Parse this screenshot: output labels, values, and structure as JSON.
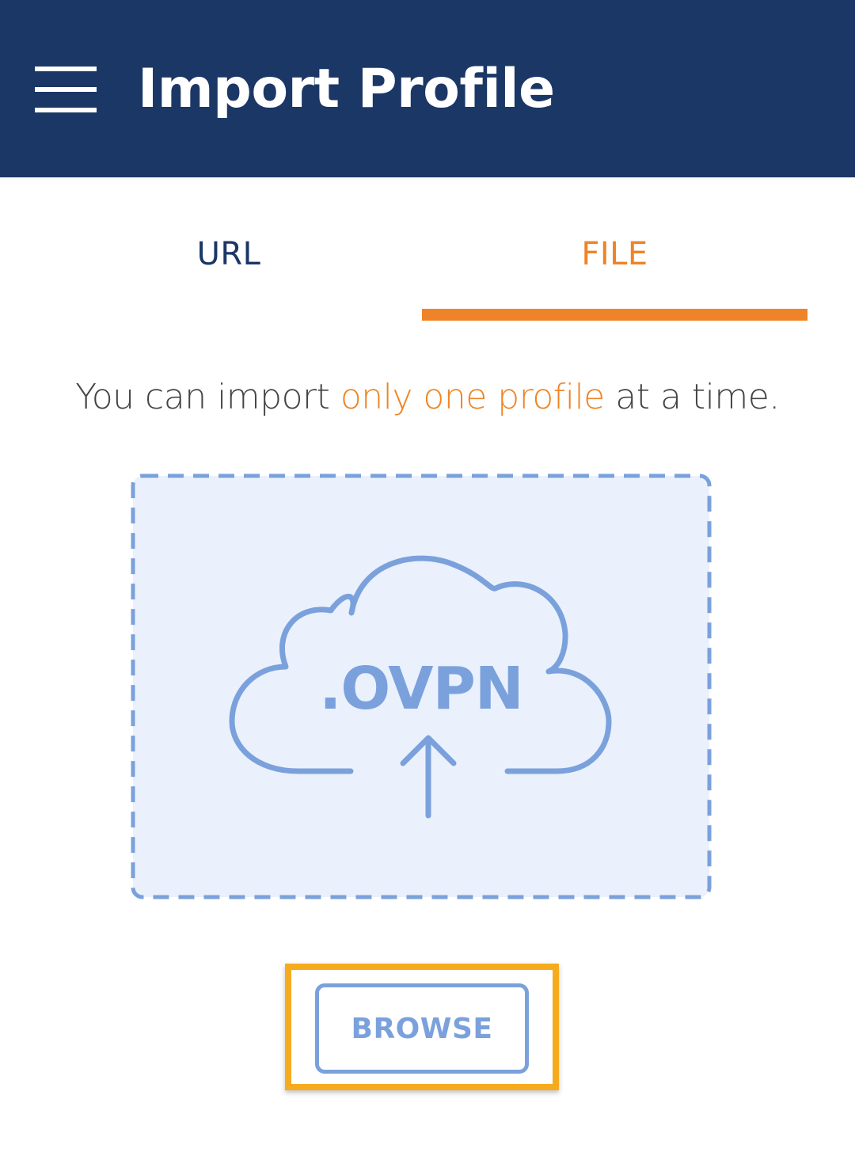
{
  "header": {
    "title": "Import Profile",
    "menu_icon": "hamburger-menu-icon",
    "background_color": "#1b3766"
  },
  "tabs": [
    {
      "label": "URL",
      "selected": false
    },
    {
      "label": "FILE",
      "selected": true
    }
  ],
  "hint": {
    "before": "You can import ",
    "highlight": "only one profile",
    "after": " at a time."
  },
  "dropzone": {
    "label": ".OVPN",
    "icon": "cloud-upload-icon"
  },
  "browse_button": {
    "label": "BROWSE"
  },
  "colors": {
    "accent": "#ee8427",
    "primary": "#1b3766",
    "dropzone": "#7ba1dc",
    "highlight_frame": "#f6ab1e"
  }
}
